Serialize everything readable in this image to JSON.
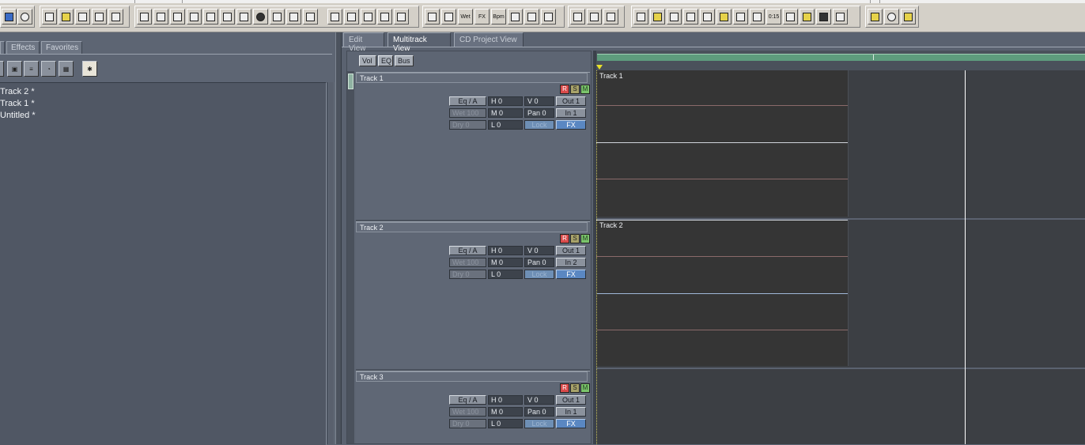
{
  "left_panel": {
    "tabs": [
      "Effects",
      "Favorites"
    ],
    "files": [
      "Track 2 *",
      "Track 1 *",
      "Untitled *"
    ]
  },
  "views": {
    "tabs": [
      "Edit View",
      "Multitrack View",
      "CD Project View"
    ],
    "active": "Multitrack View"
  },
  "mixer_buttons": [
    "Vol",
    "EQ",
    "Bus"
  ],
  "toolbar": {
    "text_buttons": [
      "Wet",
      "FX",
      "Bpm",
      "0:15"
    ]
  },
  "tracks": [
    {
      "name": "Track 1",
      "record": "R",
      "solo": "S",
      "mute": "M",
      "eq": "Eq / A",
      "h": "H  0",
      "v": "V 0",
      "out": "Out 1",
      "wet": "Wet 100",
      "m": "M  0",
      "pan": "Pan 0",
      "in": "In 1",
      "dry": "Dry 0",
      "l": "L  0",
      "lock": "Lock",
      "fx": "FX"
    },
    {
      "name": "Track 2",
      "record": "R",
      "solo": "S",
      "mute": "M",
      "eq": "Eq / A",
      "h": "H  0",
      "v": "V 0",
      "out": "Out 1",
      "wet": "Wet 100",
      "m": "M  0",
      "pan": "Pan 0",
      "in": "In 2",
      "dry": "Dry 0",
      "l": "L  0",
      "lock": "Lock",
      "fx": "FX"
    },
    {
      "name": "Track 3",
      "record": "R",
      "solo": "S",
      "mute": "M",
      "eq": "Eq / A",
      "h": "H  0",
      "v": "V 0",
      "out": "Out 1",
      "wet": "Wet 100",
      "m": "M  0",
      "pan": "Pan 0",
      "in": "In 1",
      "dry": "Dry 0",
      "l": "L  0",
      "lock": "Lock",
      "fx": "FX"
    }
  ],
  "timeline": {
    "clips": [
      "Track 1",
      "Track 2"
    ]
  },
  "colors": {
    "record": "#d94a4a",
    "solo": "#a8a36a",
    "mute": "#7bc46c",
    "fx": "#5a87c2",
    "ruler": "#5e9c7d"
  }
}
